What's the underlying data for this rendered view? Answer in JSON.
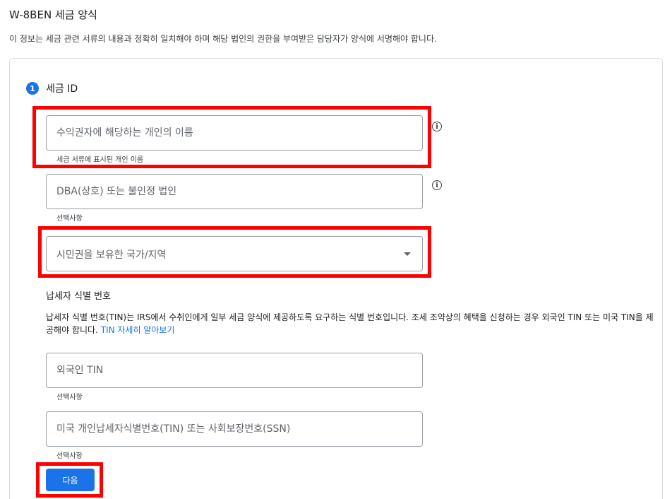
{
  "header": {
    "title": "W-8BEN 세금 양식",
    "description": "이 정보는 세금 관련 서류의 내용과 정확히 일치해야 하며 해당 법인의 권한을 부여받은 담당자가 양식에 서명해야 합니다."
  },
  "step": {
    "number": "1",
    "title": "세금 ID"
  },
  "fields": {
    "beneficiary_name": {
      "placeholder": "수익권자에 해당하는 개인의 이름",
      "value": "",
      "helper": "세금 서류에 표시된 개인 이름"
    },
    "dba_name": {
      "placeholder": "DBA(상호) 또는 불인정 법인",
      "value": "",
      "helper": "선택사항"
    },
    "citizenship_country": {
      "selected": "시민권을 보유한 국가/지역"
    },
    "foreign_tin": {
      "placeholder": "외국인 TIN",
      "value": "",
      "helper": "선택사항"
    },
    "us_tin": {
      "placeholder": "미국 개인납세자식별번호(TIN) 또는 사회보장번호(SSN)",
      "value": "",
      "helper": "선택사항"
    }
  },
  "tin_section": {
    "title": "납세자 식별 번호",
    "description": "납세자 식별 번호(TIN)는 IRS에서 수취인에게 일부 세금 양식에 제공하도록 요구하는 식별 번호입니다. 조세 조약상의 혜택을 신청하는 경우 외국인 TIN 또는 미국 TIN을 제공해야 합니다.",
    "link": "TIN 자세히 알아보기"
  },
  "actions": {
    "next_label": "다음"
  },
  "icons": {
    "info": "info-icon",
    "dropdown": "caret-down-icon"
  },
  "colors": {
    "accent": "#1a73e8",
    "highlight": "#ff0000",
    "border": "#9aa0a6"
  }
}
